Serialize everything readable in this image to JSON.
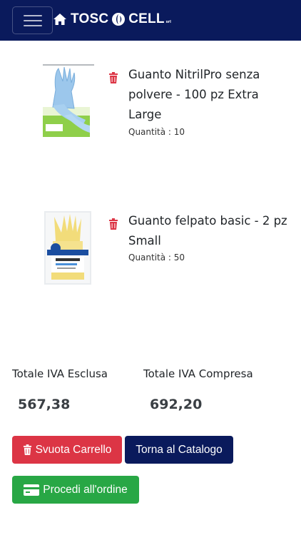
{
  "header": {
    "brand_name": "TOSC",
    "brand_name_2": "CELL",
    "brand_suffix": "srl",
    "home_icon": "home-icon",
    "menu_icon": "hamburger-icon",
    "brand_color": "#0a1a5c"
  },
  "cart": {
    "items": [
      {
        "name": "Guanto NitrilPro senza polvere - 100 pz Extra Large",
        "quantity_label": "Quantità : 10",
        "remove_icon": "trash-icon"
      },
      {
        "name": "Guanto felpato basic - 2 pz Small",
        "quantity_label": "Quantità : 50",
        "remove_icon": "trash-icon"
      }
    ]
  },
  "totals": {
    "excl_label": "Totale IVA Esclusa",
    "excl_value": "567,38",
    "incl_label": "Totale IVA Compresa",
    "incl_value": "692,20"
  },
  "actions": {
    "empty_cart_label": "Svuota Carrello",
    "back_to_catalog_label": "Torna al Catalogo",
    "checkout_label": "Procedi all'ordine"
  },
  "colors": {
    "danger": "#dc3545",
    "primary": "#0a1a5c",
    "success": "#28a745"
  }
}
